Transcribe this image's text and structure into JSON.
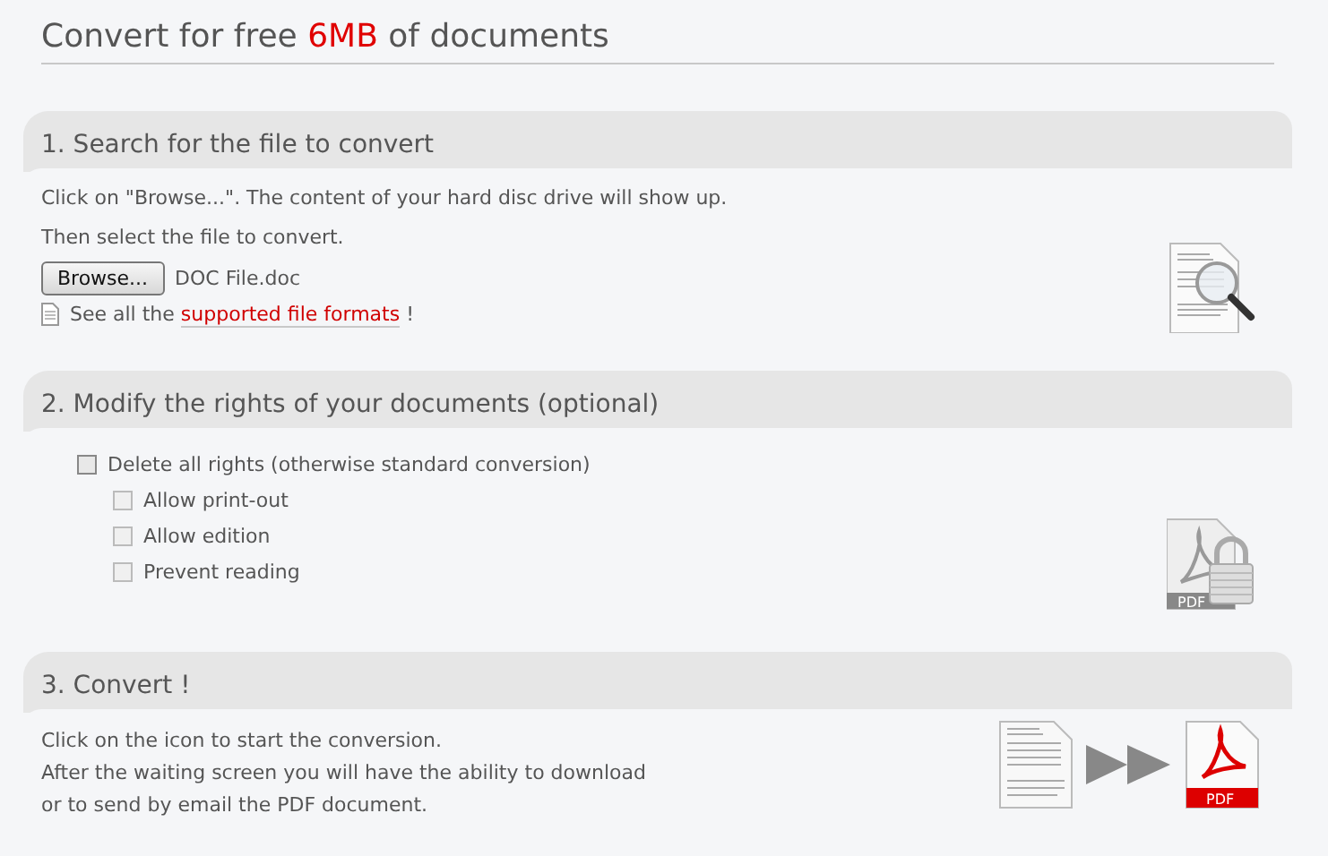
{
  "title": {
    "text": "Convert for free **6MB** of documents"
  },
  "sections": [
    {
      "kind": "search",
      "heading": "1. Search for the file to convert",
      "lines": [
        "Click on \"Browse...\". The content of your hard disc drive will show up.",
        "Then select the file to convert."
      ],
      "browse_button": "Browse...",
      "file_name": "DOC File.doc",
      "formats_prefix": "See all the",
      "formats_link": "supported file formats",
      "formats_suffix": "!"
    },
    {
      "kind": "rights",
      "heading": "2. Modify the rights of your documents (optional)",
      "main_option": {
        "label": "Delete all rights (otherwise standard conversion)",
        "checked": false
      },
      "options": [
        {
          "label": "Allow print-out",
          "checked": false,
          "disabled": true
        },
        {
          "label": "Allow edition",
          "checked": false,
          "disabled": true
        },
        {
          "label": "Prevent reading",
          "checked": false,
          "disabled": true
        }
      ],
      "icon_label": "PDF"
    },
    {
      "kind": "convert",
      "heading": "3. Convert !",
      "lines": [
        "Click on the icon to start the conversion.",
        "After the waiting screen you will have the ability to download",
        "or to send by email the PDF document."
      ],
      "icon_label": "PDF"
    }
  ]
}
